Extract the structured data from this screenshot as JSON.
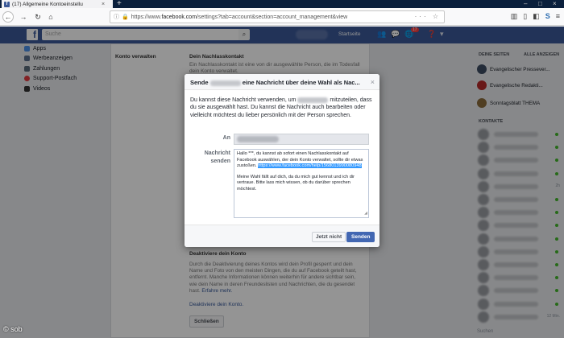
{
  "browser": {
    "tab_title": "(17) Allgemeine Kontoeinstellu",
    "url_prefix": "https://www.",
    "url_domain": "facebook.com",
    "url_path": "/settings?tab=account&section=account_management&view"
  },
  "fb": {
    "search_placeholder": "Suche",
    "startseite": "Startseite",
    "notif_count": "17"
  },
  "leftnav": {
    "items": [
      "Apps",
      "Werbeanzeigen",
      "Zahlungen",
      "Support-Postfach",
      "Videos"
    ]
  },
  "settings": {
    "section_label": "Konto verwalten",
    "nachlass_title": "Dein Nachlasskontakt",
    "nachlass_blurb": "Ein Nachlasskontakt ist eine von dir ausgewählte Person, die im Todesfall dein Konto verwaltet.",
    "deakt_title": "Deaktiviere dein Konto",
    "deakt_text": "Durch die Deaktivierung deines Kontos wird dein Profil gesperrt und dein Name und Foto von den meisten Dingen, die du auf Facebook geteilt hast, entfernt. Manche Informationen können weiterhin für andere sichtbar sein, wie dein Name in deren Freundeslisten und Nachrichten, die du gesendet hast.",
    "mehr": "Erfahre mehr.",
    "deakt_link": "Deaktiviere dein Konto.",
    "close_button": "Schließen"
  },
  "rightcol": {
    "pages_head": "DEINE SEITEN",
    "all_pages": "ALLE ANZEIGEN",
    "pages": [
      "Evangelischer Pressever...",
      "Evangelische Redakti...",
      "Sonntagsblatt THEMA"
    ],
    "contacts_head": "KONTAKTE",
    "contact_times": [
      "",
      "",
      "",
      "",
      "2h",
      "",
      "",
      "",
      "",
      "",
      "",
      "",
      "",
      "",
      "12 Min."
    ],
    "search": "Suchen"
  },
  "dialog": {
    "title_prefix": "Sende",
    "title_suffix": "eine Nachricht über deine Wahl als Nac...",
    "intro_a": "Du kannst diese Nachricht verwenden, um",
    "intro_b": "mitzuteilen, dass du sie ausgewählt hast. Du kannst die Nachricht auch bearbeiten oder vielleicht möchtest du lieber persönlich mit der Person sprechen.",
    "an_label": "An",
    "msg_label_1": "Nachricht",
    "msg_label_2": "senden",
    "msg_p1": "Hallo ***, du kannst ab sofort einen Nachlasskontakt auf Facebook auswählen, der dein Konto verwaltet, sollte dir etwas zustoßen.",
    "msg_link": "https://www.facebook.com/help/1568013990080948",
    "msg_p2": "Meine Wahl fällt auf dich, da du mich gut kennst und ich dir vertraue. Bitte lass mich wissen, ob du darüber sprechen möchtest.",
    "btn_later": "Jetzt nicht",
    "btn_send": "Senden"
  },
  "watermark": "© sob"
}
